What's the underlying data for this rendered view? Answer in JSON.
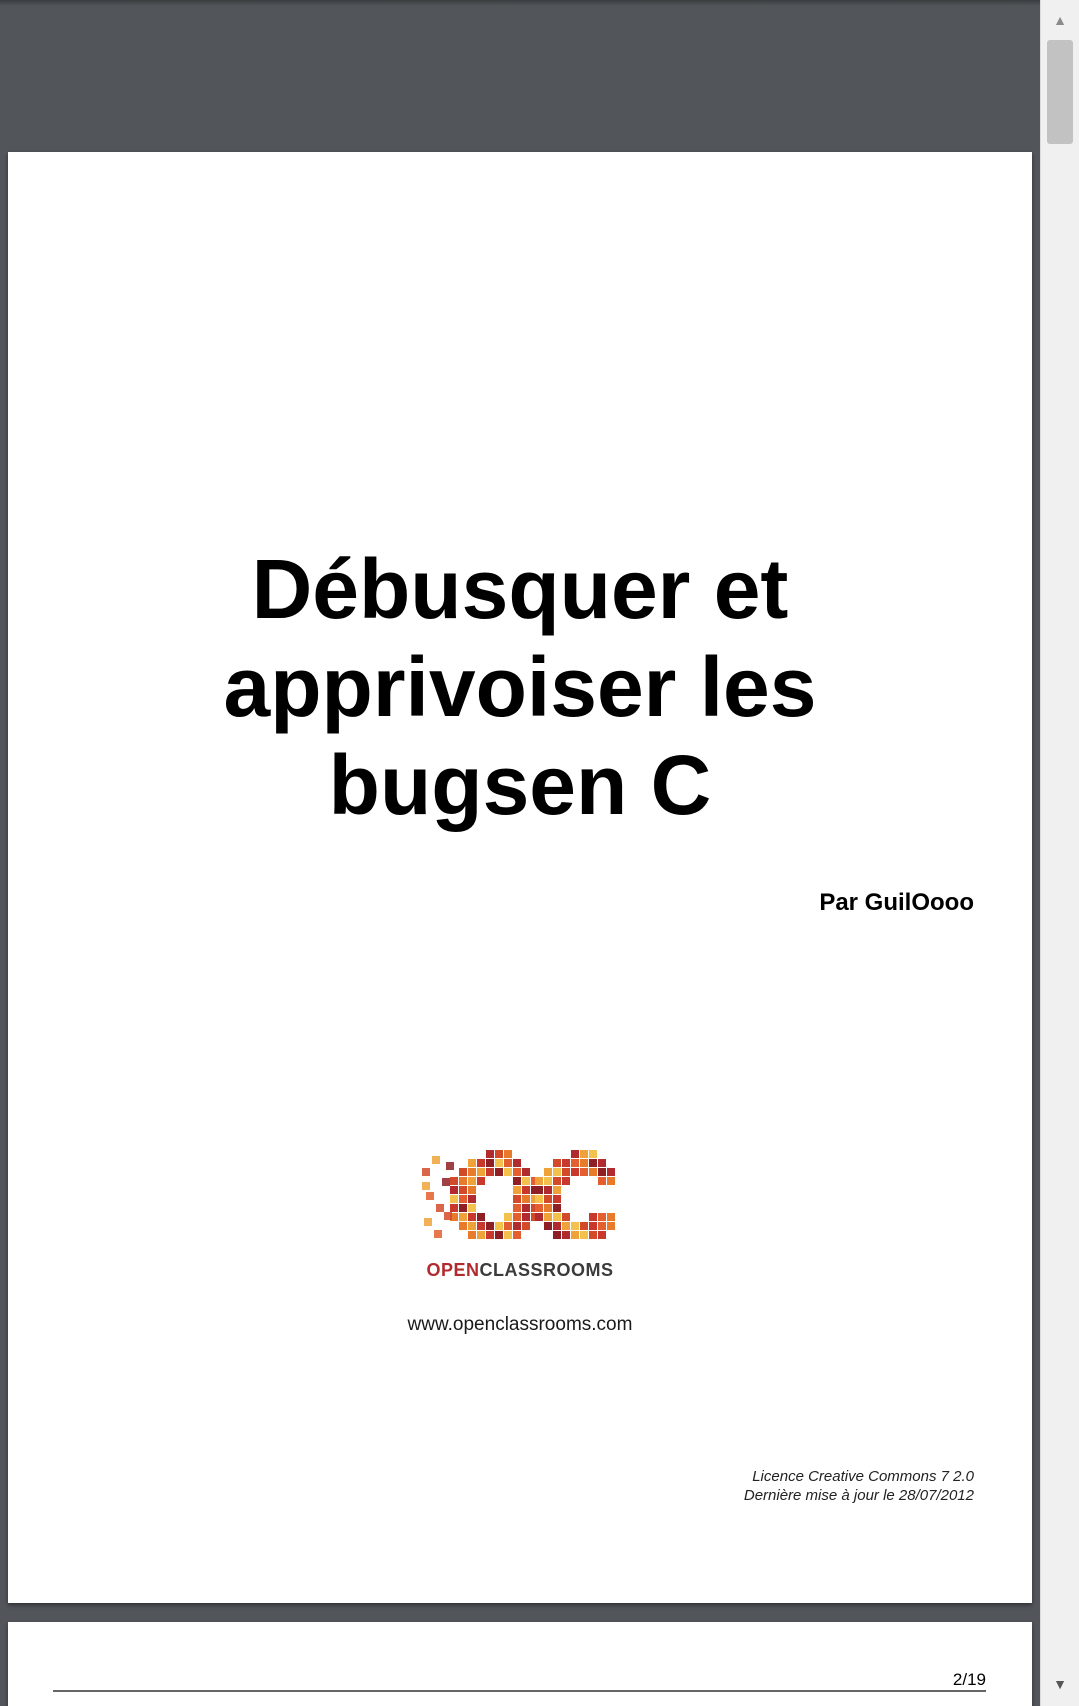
{
  "document": {
    "title_lines": [
      "Débusquer et",
      "apprivoiser les",
      "bugsen C"
    ],
    "author": "Par GuilOooo",
    "logo": {
      "icon": "openclassrooms-logo-icon",
      "text_open": "OPEN",
      "text_classrooms": "CLASSROOMS"
    },
    "website": "www.openclassrooms.com",
    "license_line1": "Licence Creative Commons 7 2.0",
    "license_line2": "Dernière mise à jour le 28/07/2012"
  },
  "next_page": {
    "page_number": "2/19"
  },
  "scrollbar": {
    "up_icon": "scroll-up-arrow-icon",
    "down_icon": "scroll-down-arrow-icon",
    "up_glyph": "▲",
    "down_glyph": "▼"
  },
  "colors": {
    "viewer_background": "#52565a",
    "logo_red": "#b02a2e",
    "logo_orange": "#e87a2c"
  }
}
